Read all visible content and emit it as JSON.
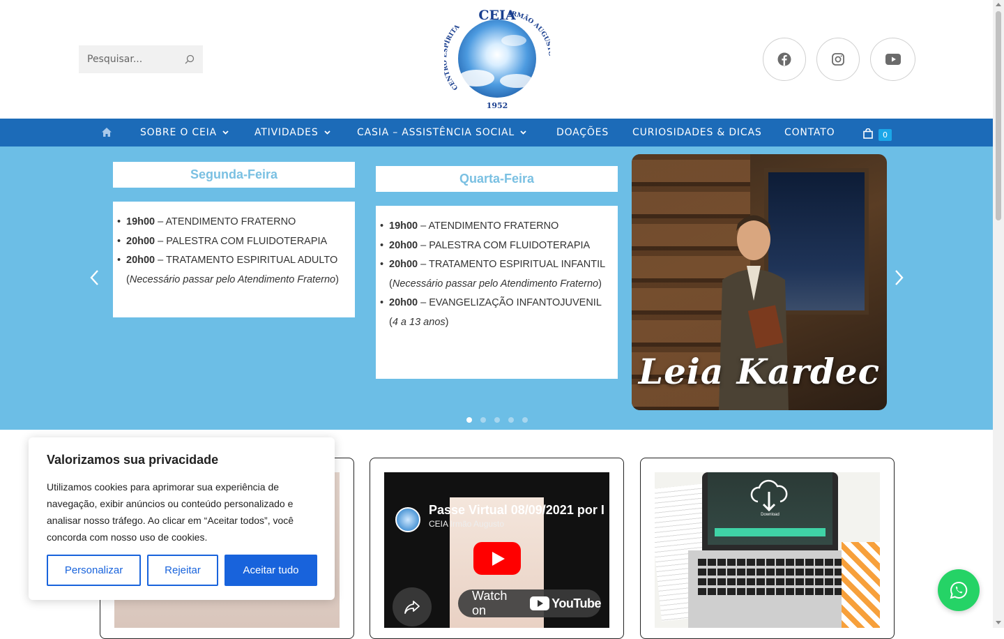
{
  "header": {
    "search": {
      "placeholder": "Pesquisar..."
    },
    "logo": {
      "top_text": "CEIA",
      "left_text": "CENTRO ESPÍRITA",
      "right_text": "IRMÃO AUGUSTO",
      "year": "1952"
    },
    "socials": [
      {
        "icon": "facebook-icon"
      },
      {
        "icon": "instagram-icon"
      },
      {
        "icon": "youtube-icon"
      }
    ]
  },
  "nav": {
    "items": [
      {
        "label": "SOBRE O CEIA",
        "has_dropdown": true
      },
      {
        "label": "ATIVIDADES",
        "has_dropdown": true
      },
      {
        "label": "CASIA – ASSISTÊNCIA SOCIAL",
        "has_dropdown": true
      },
      {
        "label": "DOAÇÕES",
        "has_dropdown": false
      },
      {
        "label": "CURIOSIDADES & DICAS",
        "has_dropdown": false
      },
      {
        "label": "CONTATO",
        "has_dropdown": false
      }
    ],
    "cart_count": "0",
    "color": "#1c6bb8"
  },
  "slider": {
    "background": "#6cbee6",
    "monday": {
      "title": "Segunda-Feira",
      "items": [
        {
          "time": "19h00",
          "text": " – ATENDIMENTO FRATERNO"
        },
        {
          "time": "20h00",
          "text": " – PALESTRA COM FLUIDOTERAPIA"
        },
        {
          "time": "20h00",
          "text": " – TRATAMENTO ESPIRITUAL ADULTO"
        }
      ],
      "note_open": "(",
      "note": "Necessário passar pelo Atendimento Fraterno",
      "note_close": ")"
    },
    "wednesday": {
      "title": "Quarta-Feira",
      "items": [
        {
          "time": "19h00",
          "text": " – ATENDIMENTO FRATERNO"
        },
        {
          "time": "20h00",
          "text": " – PALESTRA COM FLUIDOTERAPIA"
        },
        {
          "time": "20h00",
          "text": " – TRATAMENTO ESPIRITUAL INFANTIL"
        }
      ],
      "note": "Necessário passar pelo Atendimento Fraterno",
      "extra_time": "20h00",
      "extra_text": " – EVANGELIZAÇÃO INFANTOJUVENIL",
      "extra_note": "4 a 13 anos"
    },
    "banner": {
      "title": "Leia Kardec"
    },
    "dots": 5,
    "active_dot": 0
  },
  "video": {
    "title": "Passe Virtual 08/09/2021 por I",
    "channel": "CEIA Irmão Augusto",
    "watch_label": "Watch on",
    "brand": "YouTube"
  },
  "laptop": {
    "download_label": "Download"
  },
  "cookie": {
    "title": "Valorizamos sua privacidade",
    "text": "Utilizamos cookies para aprimorar sua experiência de navegação, exibir anúncios ou conteúdo personalizado e analisar nosso tráfego. Ao clicar em “Aceitar todos”, você concorda com nosso uso de cookies.",
    "customize": "Personalizar",
    "reject": "Rejeitar",
    "accept": "Aceitar tudo",
    "accent": "#1863dc"
  },
  "whatsapp": {
    "icon": "whatsapp-icon",
    "color": "#25d366"
  }
}
